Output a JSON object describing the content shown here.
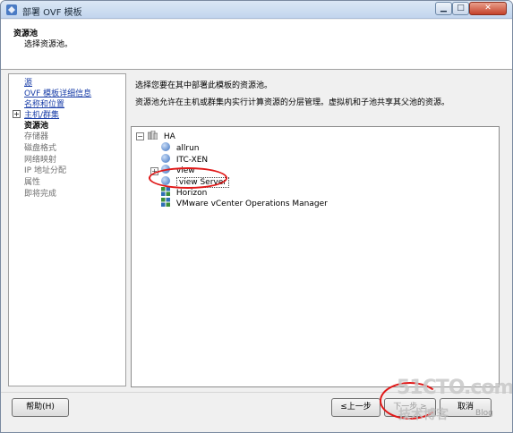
{
  "window": {
    "title": "部署 OVF 模板",
    "min_glyph": "▁",
    "max_glyph": "□",
    "close_glyph": "✕"
  },
  "header": {
    "title": "资源池",
    "subtitle": "选择资源池。"
  },
  "nav": {
    "expand_glyph": "+",
    "items": [
      {
        "label": "源",
        "state": "link"
      },
      {
        "label": "OVF 模板详细信息",
        "state": "link"
      },
      {
        "label": "名称和位置",
        "state": "link"
      },
      {
        "label": "主机/群集",
        "state": "link"
      },
      {
        "label": "资源池",
        "state": "active"
      },
      {
        "label": "存储器",
        "state": "disabled"
      },
      {
        "label": "磁盘格式",
        "state": "disabled"
      },
      {
        "label": "网络映射",
        "state": "disabled"
      },
      {
        "label": "IP 地址分配",
        "state": "disabled"
      },
      {
        "label": "属性",
        "state": "disabled"
      },
      {
        "label": "即将完成",
        "state": "disabled"
      }
    ]
  },
  "content": {
    "prompt": "选择您要在其中部署此模板的资源池。",
    "description": "资源池允许在主机或群集内实行计算资源的分层管理。虚拟机和子池共享其父池的资源。"
  },
  "tree": {
    "collapse_glyph": "−",
    "expand_glyph": "+",
    "root": "HA",
    "children": [
      {
        "label": "allrun",
        "icon": "resource-pool-icon"
      },
      {
        "label": "ITC-XEN",
        "icon": "resource-pool-icon"
      },
      {
        "label": "view",
        "icon": "resource-pool-icon",
        "expandable": true
      },
      {
        "label": "view Server",
        "icon": "resource-pool-icon",
        "selected": true
      },
      {
        "label": "Horizon",
        "icon": "vapp-icon"
      },
      {
        "label": "VMware vCenter Operations Manager",
        "icon": "vapp-icon"
      }
    ]
  },
  "buttons": {
    "help": "帮助(H)",
    "back": "≤上一步",
    "next": "下一步 ≥",
    "cancel": "取消"
  },
  "watermark": {
    "main": "51CTO.com",
    "sub": "技术博客",
    "blog": "Blog"
  },
  "colors": {
    "link": "#1a3ea8",
    "annotation": "#e01818"
  }
}
